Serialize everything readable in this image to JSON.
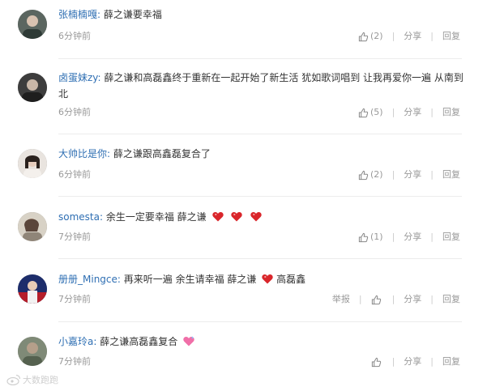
{
  "comments": [
    {
      "user": "张楠楠嘎:",
      "lines": [
        "薛之谦要幸福"
      ],
      "time": "6分钟前",
      "likes": "(2)",
      "share": "分享",
      "reply": "回复",
      "report": ""
    },
    {
      "user": "卤蛋妹zy:",
      "lines": [
        "薛之谦和高磊鑫终于重新在一起开始了新生活 犹如歌词唱到 让我再爱你一遍 从南到",
        "北"
      ],
      "time": "6分钟前",
      "likes": "(5)",
      "share": "分享",
      "reply": "回复",
      "report": ""
    },
    {
      "user": "大帅比是你:",
      "lines": [
        "薛之谦跟高鑫磊复合了"
      ],
      "time": "6分钟前",
      "likes": "(2)",
      "share": "分享",
      "reply": "回复",
      "report": ""
    },
    {
      "user": "somesta:",
      "lines": [
        "余生一定要幸福 薛之谦"
      ],
      "time": "7分钟前",
      "likes": "(1)",
      "share": "分享",
      "reply": "回复",
      "report": ""
    },
    {
      "user": "册册_Mingce:",
      "lines": [
        "再来听一遍 余生请幸福 薛之谦"
      ],
      "tail": "高磊鑫",
      "time": "7分钟前",
      "likes": "",
      "share": "分享",
      "reply": "回复",
      "report": "举报"
    },
    {
      "user": "小嘉玲a:",
      "lines": [
        "薛之谦高磊鑫复合"
      ],
      "time": "7分钟前",
      "likes": "",
      "share": "分享",
      "reply": "回复",
      "report": ""
    }
  ],
  "watermark": "大数跑跑",
  "colors": {
    "username": "#2f6fb3",
    "meta": "#999999",
    "heart": "#d9262b"
  }
}
